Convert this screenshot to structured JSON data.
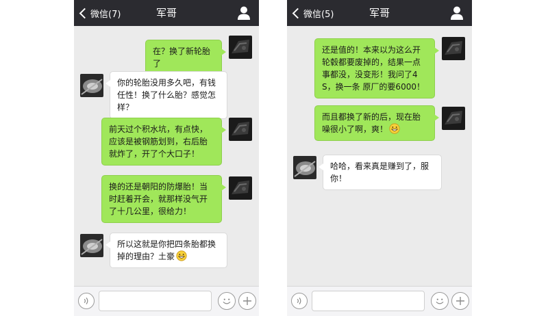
{
  "left": {
    "back_label": "微信(7)",
    "title": "军哥",
    "messages": [
      {
        "side": "sent",
        "text": "在？换了新轮胎了"
      },
      {
        "side": "recv",
        "text": "你的轮胎没用多久吧，有钱任性！换了什么胎？感觉怎样？"
      },
      {
        "side": "sent",
        "text": "前天过个积水坑，有点快，应该是被钢筋划到，右后胎就炸了，开了个大口子！"
      },
      {
        "side": "sent",
        "text": "换的还是朝阳的防爆胎！当时赶着开会，就那样没气开了十几公里，很给力！"
      },
      {
        "side": "recv",
        "text": "所以这就是你把四条胎都换掉的理由？土豪",
        "emoji": "grin-emoji"
      }
    ]
  },
  "right": {
    "back_label": "微信(5)",
    "title": "军哥",
    "messages": [
      {
        "side": "sent",
        "text": "还是值的！本来以为这么开轮毂都要废掉的，结果一点事都没，没变形！我问了4S，换一条 原厂的要6000！"
      },
      {
        "side": "sent",
        "text": "而且都换了新的后，现在胎噪很小了啊，爽！",
        "emoji": "grin-emoji"
      },
      {
        "side": "recv",
        "text": "哈哈，看来真是赚到了，服你！"
      }
    ]
  },
  "input_bar": {
    "placeholder": "",
    "icons": [
      "voice-icon",
      "emoji-icon",
      "plus-icon"
    ]
  },
  "colors": {
    "header_bg": "#2b2b30",
    "chat_bg": "#ebebeb",
    "sent_bubble": "#a0e75a",
    "recv_bubble": "#ffffff"
  }
}
